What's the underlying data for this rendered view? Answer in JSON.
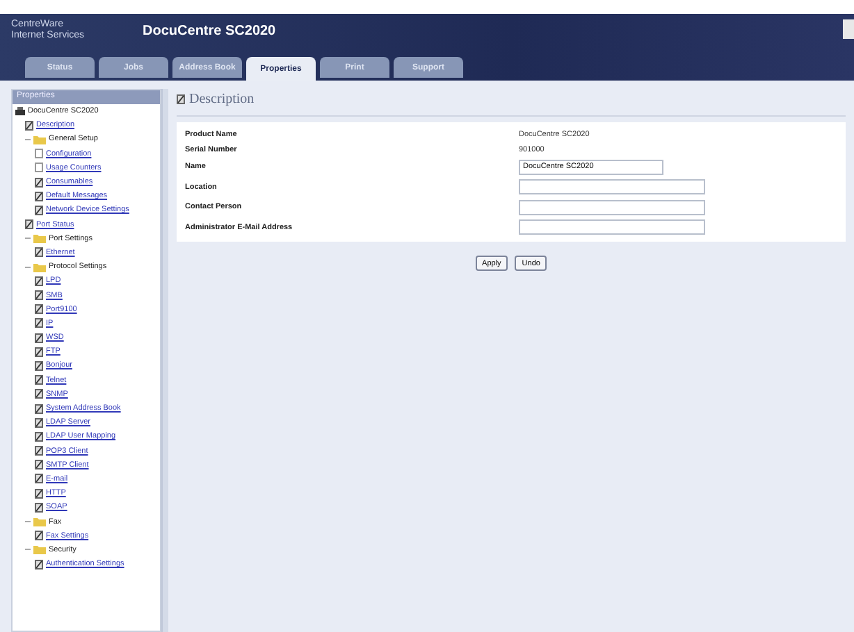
{
  "brand": {
    "line1": "CentreWare",
    "line2": "Internet Services"
  },
  "window": {
    "title": "DocuCentre SC2020"
  },
  "tabs": [
    {
      "label": "Status",
      "selected": false
    },
    {
      "label": "Jobs",
      "selected": false
    },
    {
      "label": "Address Book",
      "selected": false
    },
    {
      "label": "Properties",
      "selected": true
    },
    {
      "label": "Print",
      "selected": false
    },
    {
      "label": "Support",
      "selected": false
    }
  ],
  "sidebar": {
    "title": "Properties",
    "tree": [
      {
        "label": "DocuCentre SC2020",
        "kind": "device",
        "children": [
          {
            "label": "Description",
            "kind": "page"
          },
          {
            "label": "General Setup",
            "kind": "folder",
            "children": [
              {
                "label": "Configuration",
                "kind": "blank"
              },
              {
                "label": "Usage Counters",
                "kind": "blank"
              },
              {
                "label": "Consumables",
                "kind": "page"
              },
              {
                "label": "Default Messages",
                "kind": "page"
              },
              {
                "label": "Network Device Settings",
                "kind": "page"
              }
            ]
          },
          {
            "label": "Port Status",
            "kind": "page"
          },
          {
            "label": "Port Settings",
            "kind": "folder",
            "children": [
              {
                "label": "Ethernet",
                "kind": "page"
              }
            ]
          },
          {
            "label": "Protocol Settings",
            "kind": "folder",
            "children": [
              {
                "label": "LPD",
                "kind": "page"
              },
              {
                "label": "SMB",
                "kind": "page"
              },
              {
                "label": "Port9100",
                "kind": "page"
              },
              {
                "label": "IP",
                "kind": "page"
              },
              {
                "label": "WSD",
                "kind": "page"
              },
              {
                "label": "FTP",
                "kind": "page"
              },
              {
                "label": "Bonjour",
                "kind": "page"
              },
              {
                "label": "Telnet",
                "kind": "page"
              },
              {
                "label": "SNMP",
                "kind": "page"
              },
              {
                "label": "System Address Book",
                "kind": "page"
              },
              {
                "label": "LDAP Server",
                "kind": "page"
              },
              {
                "label": "LDAP User Mapping",
                "kind": "page"
              },
              {
                "label": "POP3 Client",
                "kind": "page"
              },
              {
                "label": "SMTP Client",
                "kind": "page"
              },
              {
                "label": "E-mail",
                "kind": "page"
              },
              {
                "label": "HTTP",
                "kind": "page"
              },
              {
                "label": "SOAP",
                "kind": "page"
              }
            ]
          },
          {
            "label": "Fax",
            "kind": "folder",
            "children": [
              {
                "label": "Fax Settings",
                "kind": "page"
              }
            ]
          },
          {
            "label": "Security",
            "kind": "folder",
            "children": [
              {
                "label": "Authentication Settings",
                "kind": "page"
              }
            ]
          }
        ]
      }
    ]
  },
  "panel": {
    "title": "Description",
    "fields": [
      {
        "label": "Product Name",
        "kind": "text",
        "value": "DocuCentre SC2020"
      },
      {
        "label": "Serial Number",
        "kind": "text",
        "value": "901000"
      },
      {
        "label": "Name",
        "kind": "input",
        "value": "DocuCentre SC2020"
      },
      {
        "label": "Location",
        "kind": "wideinput"
      },
      {
        "label": "Contact Person",
        "kind": "wideinput"
      },
      {
        "label": "Administrator E-Mail Address",
        "kind": "wideinput"
      }
    ]
  },
  "buttons": [
    "Apply",
    "Undo"
  ]
}
